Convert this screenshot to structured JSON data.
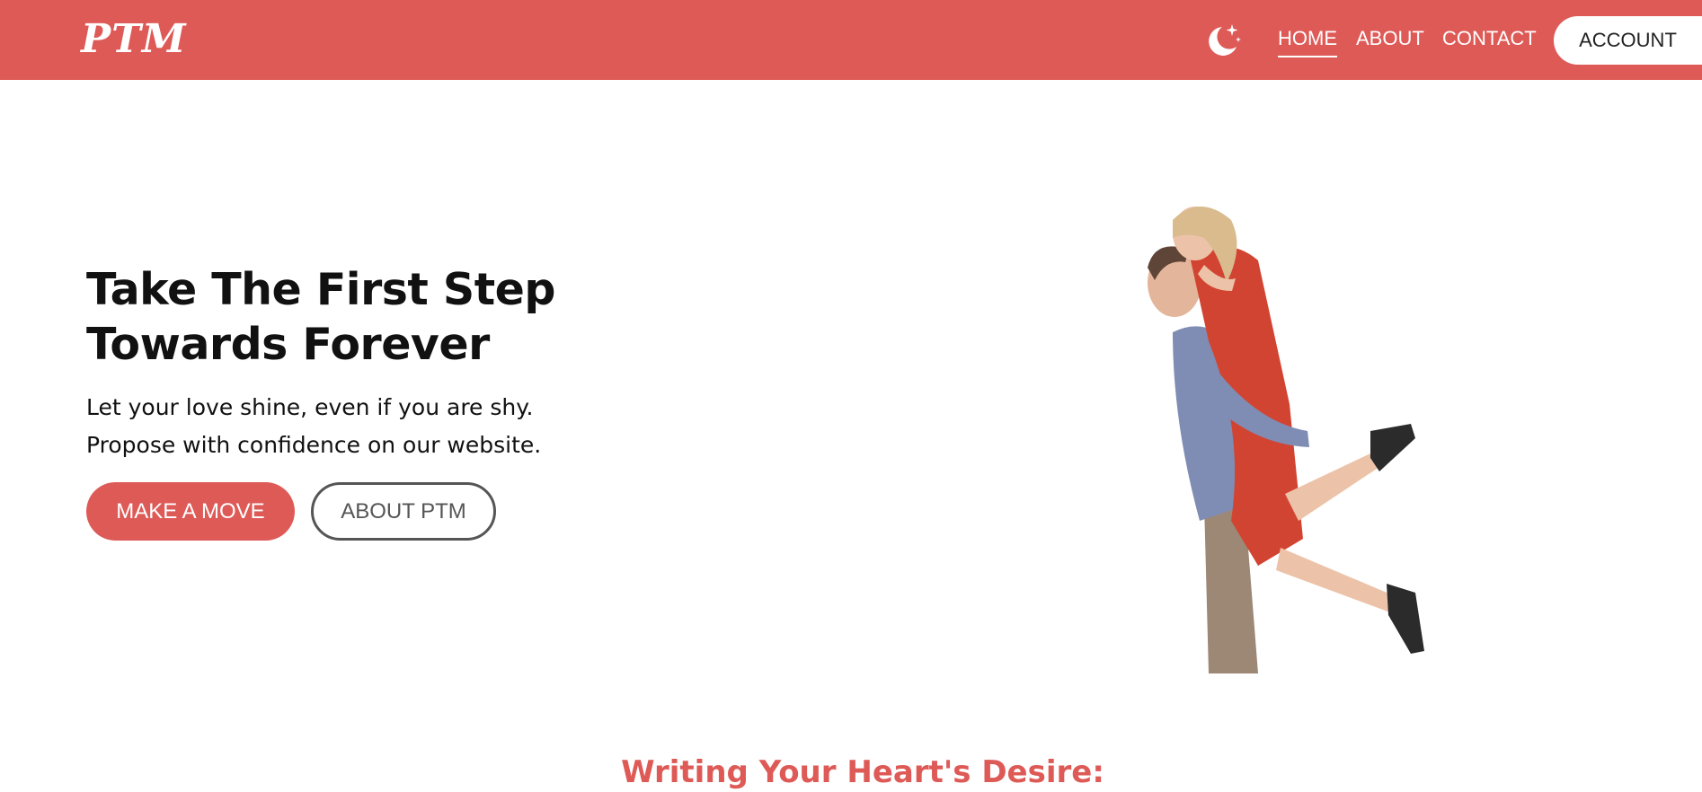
{
  "brand": {
    "logo_text": "PTM"
  },
  "colors": {
    "accent": "#de5a57",
    "white": "#ffffff",
    "text": "#111111"
  },
  "header": {
    "theme_toggle_icon": "moon-stars-icon",
    "nav": [
      {
        "label": "HOME",
        "active": true
      },
      {
        "label": "ABOUT",
        "active": false
      },
      {
        "label": "CONTACT",
        "active": false
      }
    ],
    "account_label": "ACCOUNT"
  },
  "hero": {
    "title": "Take The First Step Towards Forever",
    "subtitle_line1": "Let your love shine, even if you are shy.",
    "subtitle_line2": "Propose with confidence on our website.",
    "primary_button": "MAKE A MOVE",
    "secondary_button": "ABOUT PTM"
  },
  "section": {
    "heading": "Writing Your Heart's Desire:"
  }
}
